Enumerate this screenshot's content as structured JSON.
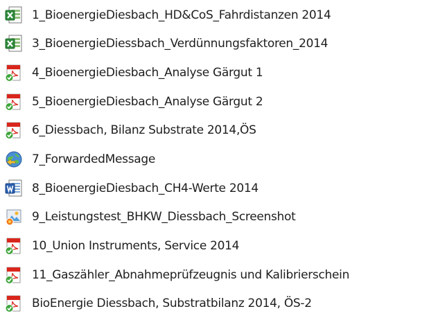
{
  "files": [
    {
      "name": "1_BioenergieDiesbach_HD&CoS_Fahrdistanzen 2014",
      "icon": "excel-file-icon"
    },
    {
      "name": "3_BioenergieDiessbach_Verdünnungsfaktoren_2014",
      "icon": "excel-file-icon"
    },
    {
      "name": "4_BioenergieDiesbach_Analyse Gärgut 1",
      "icon": "pdf-file-icon"
    },
    {
      "name": "5_BioenergieDiesbach_Analyse Gärgut 2",
      "icon": "pdf-file-icon"
    },
    {
      "name": "6_Diessbach, Bilanz Substrate 2014,ÖS",
      "icon": "pdf-file-icon"
    },
    {
      "name": "7_ForwardedMessage",
      "icon": "email-message-icon"
    },
    {
      "name": "8_BioenergieDiesbach_CH4-Werte 2014",
      "icon": "word-file-icon"
    },
    {
      "name": "9_Leistungstest_BHKW_Diessbach_Screenshot",
      "icon": "image-file-icon"
    },
    {
      "name": "10_Union Instruments, Service 2014",
      "icon": "pdf-file-icon"
    },
    {
      "name": "11_Gaszähler_Abnahmeprüfzeugnis und Kalibrierschein",
      "icon": "pdf-file-icon"
    },
    {
      "name": "BioEnergie Diessbach, Substratbilanz 2014, ÖS-2",
      "icon": "pdf-file-icon"
    }
  ]
}
